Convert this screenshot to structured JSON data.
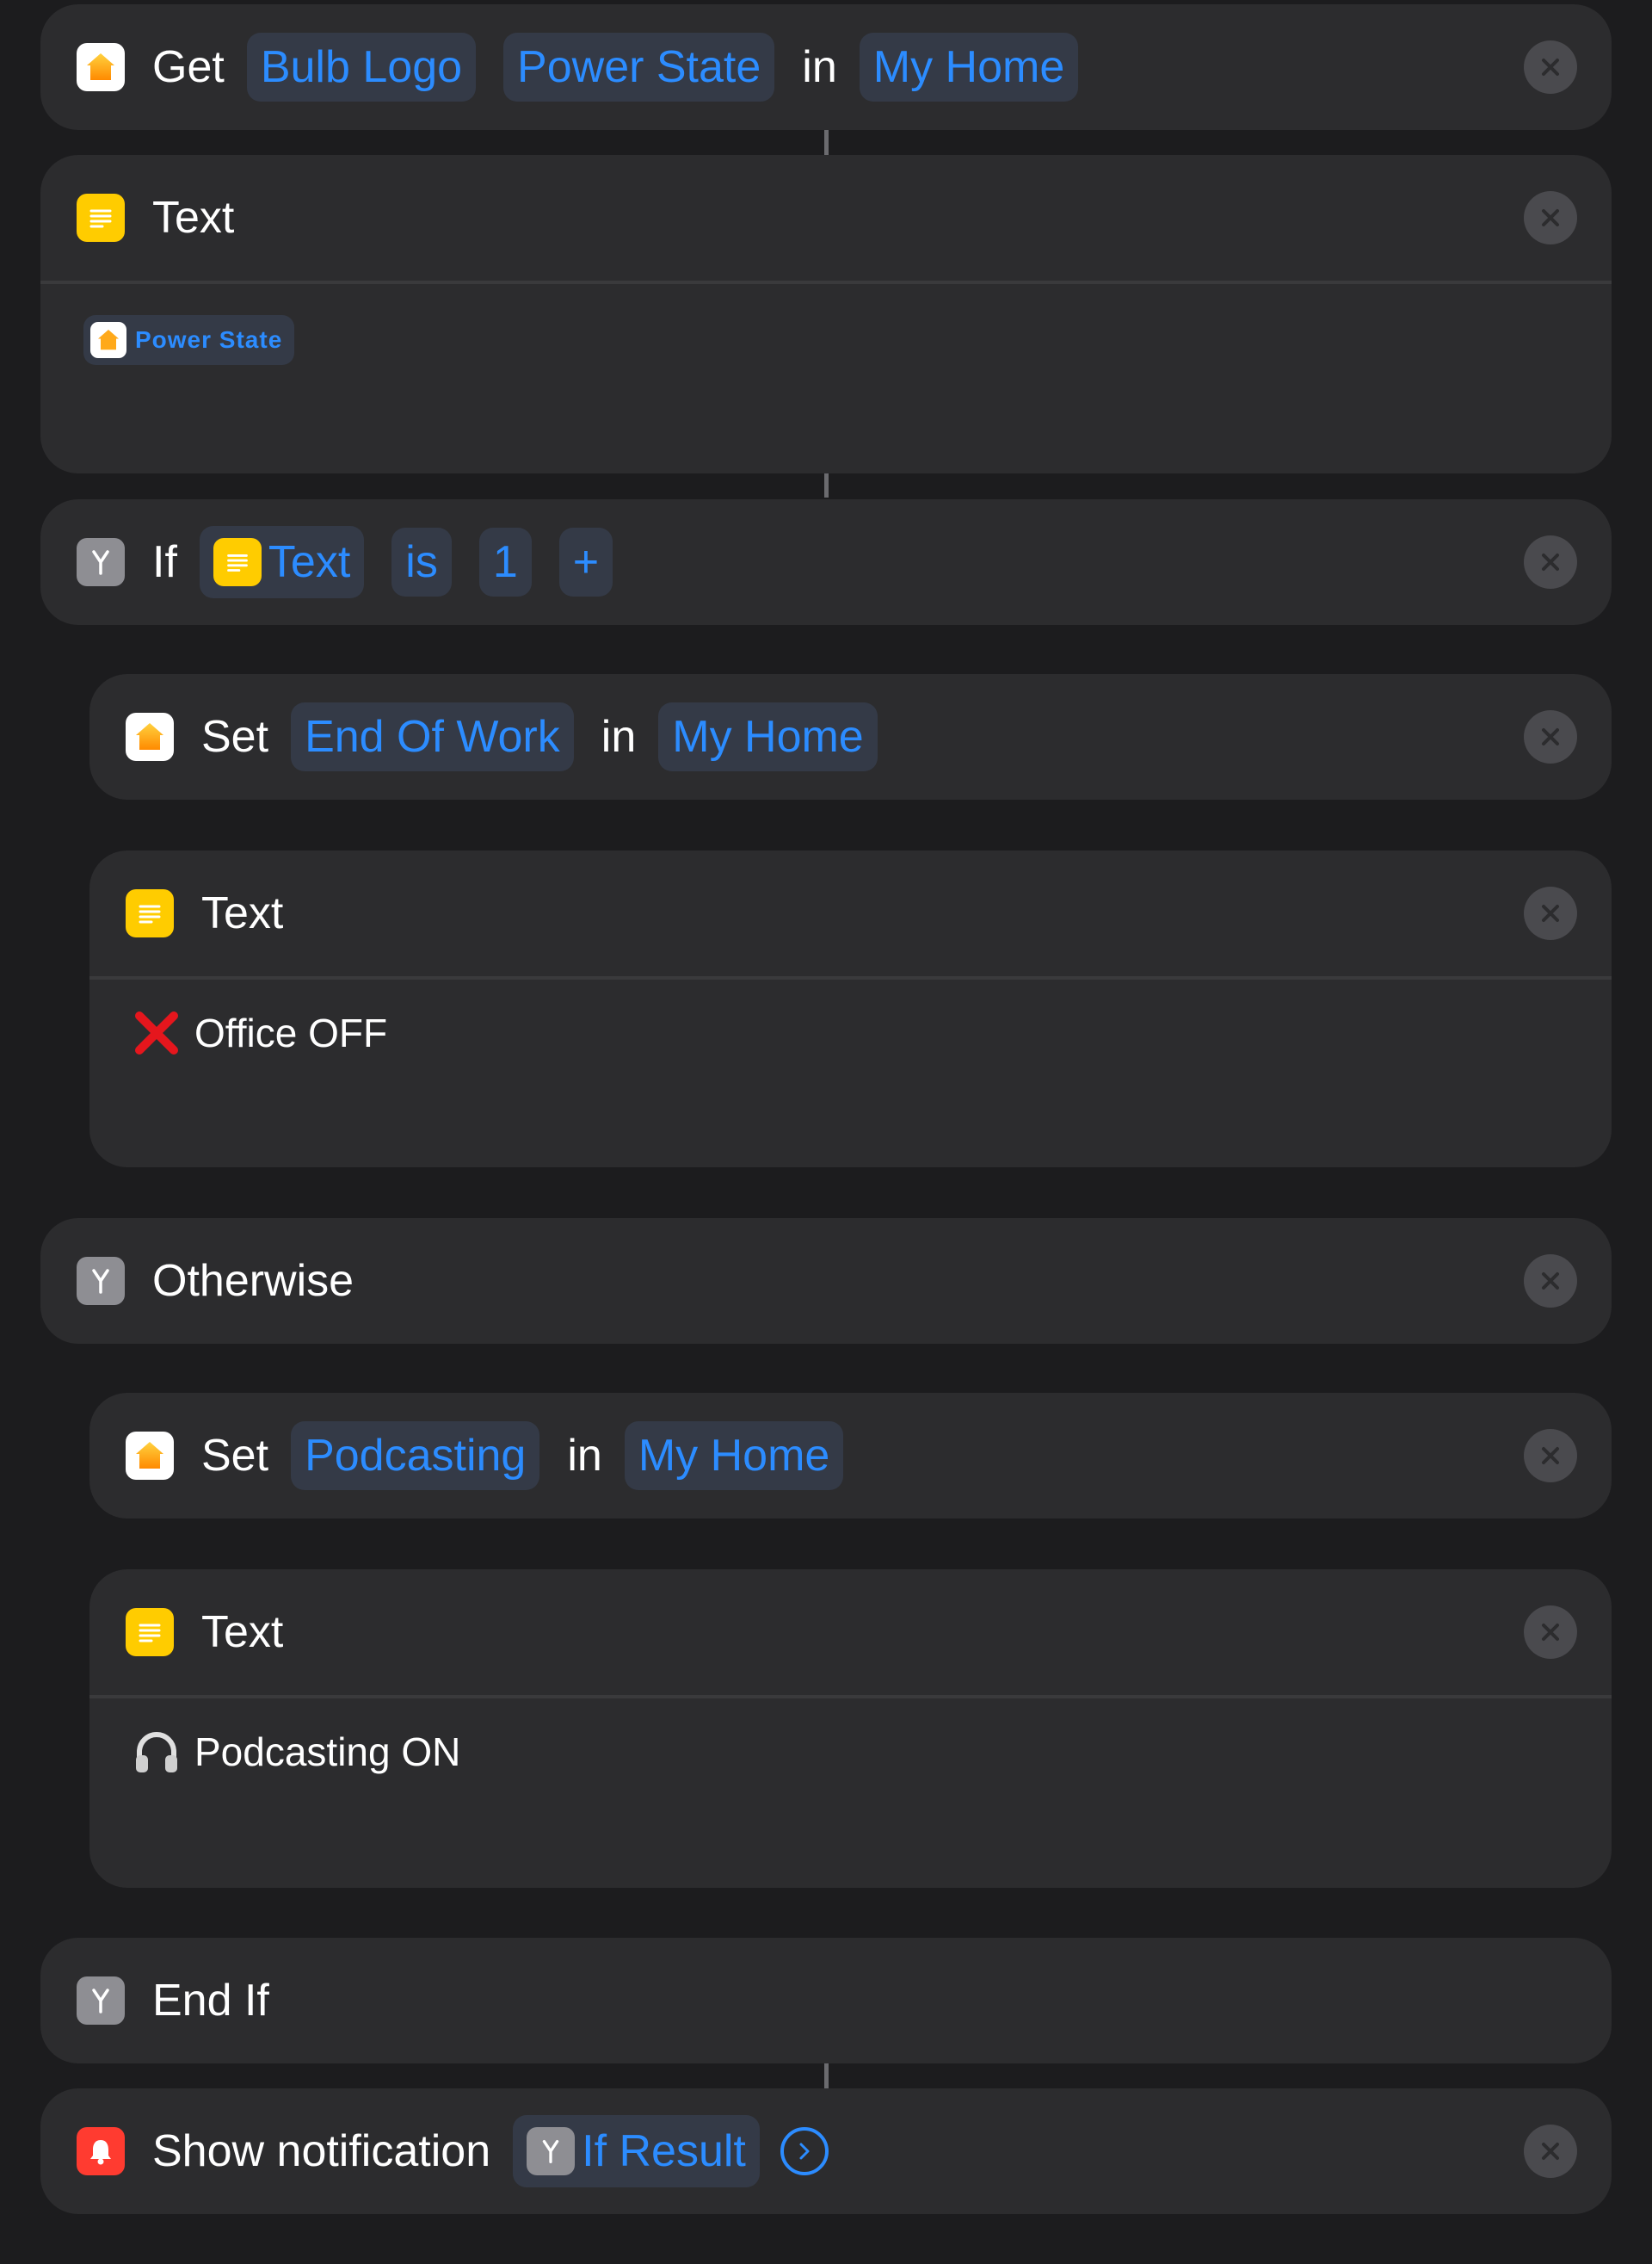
{
  "actions": {
    "get_state": {
      "verb": "Get",
      "accessory": "Bulb Logo",
      "characteristic": "Power State",
      "in": "in",
      "home": "My Home",
      "icon": "home-app-icon"
    },
    "text_1": {
      "title": "Text",
      "variable": "Power State",
      "icon": "text-icon"
    },
    "if_block": {
      "keyword": "If",
      "input": "Text",
      "condition": "is",
      "value": "1",
      "add": "+",
      "icon": "branch-icon"
    },
    "set_1": {
      "verb": "Set",
      "scene": "End Of Work",
      "in": "in",
      "home": "My Home",
      "icon": "home-app-icon"
    },
    "text_2": {
      "title": "Text",
      "content": "Office OFF",
      "emoji": "red-cross-mark"
    },
    "otherwise": {
      "label": "Otherwise",
      "icon": "branch-icon"
    },
    "set_2": {
      "verb": "Set",
      "scene": "Podcasting",
      "in": "in",
      "home": "My Home",
      "icon": "home-app-icon"
    },
    "text_3": {
      "title": "Text",
      "content": "Podcasting ON",
      "emoji": "headphones"
    },
    "end_if": {
      "label": "End If",
      "icon": "branch-icon"
    },
    "notify": {
      "label": "Show notification",
      "variable": "If Result",
      "icon": "bell-icon"
    }
  },
  "colors": {
    "background": "#1c1c1e",
    "card": "#2c2c2e",
    "accent": "#2c8cff",
    "token_bg": "#343a47",
    "text_icon": "#ffcc00",
    "branch_icon": "#8e8e93",
    "notification_icon": "#ff3b30"
  }
}
